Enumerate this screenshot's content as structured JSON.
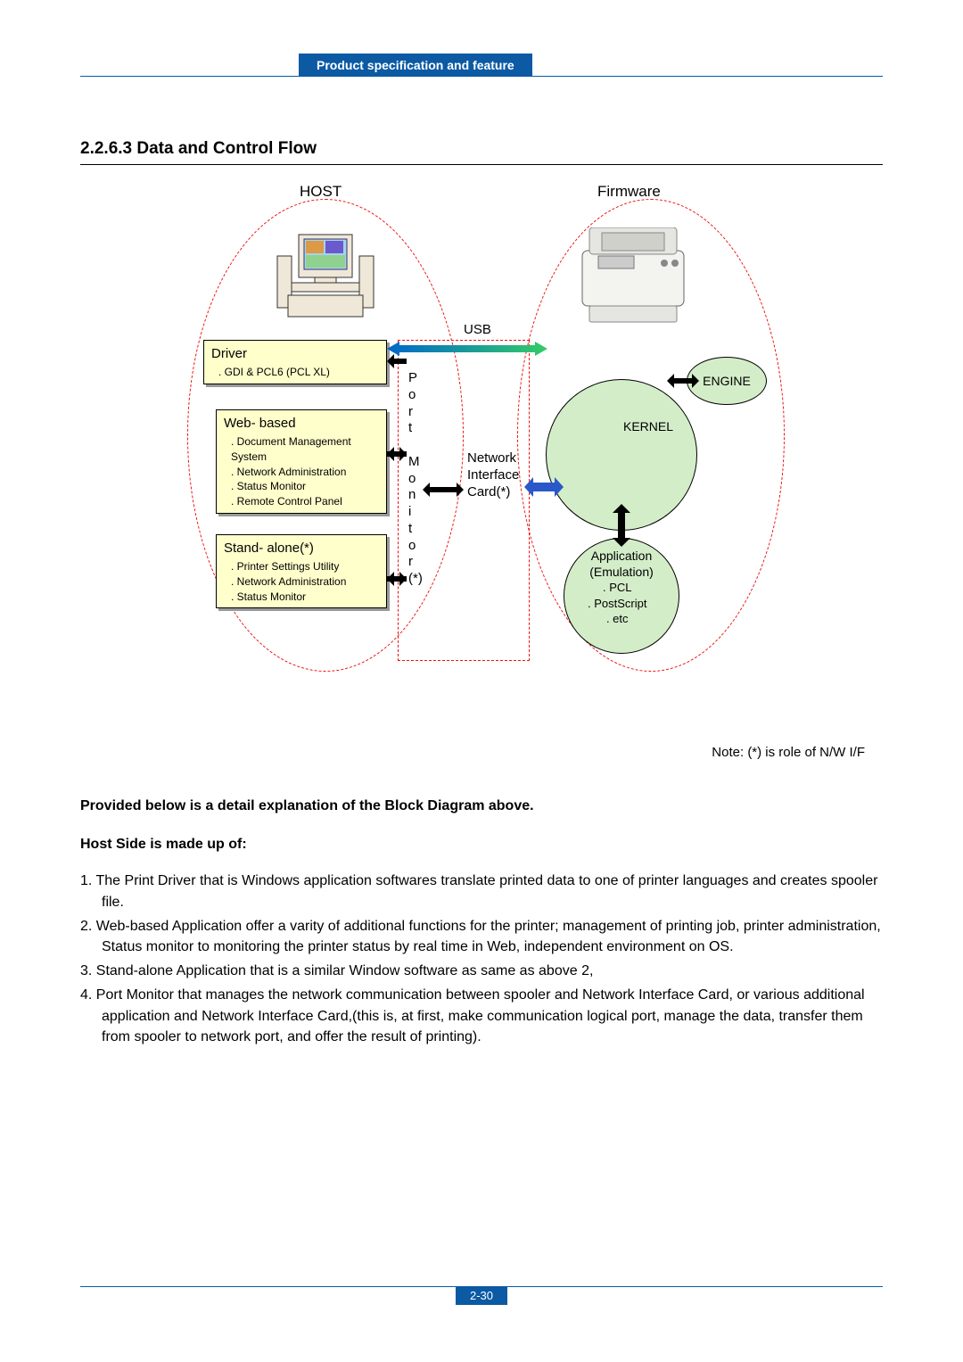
{
  "header": {
    "tab": "Product specification and feature"
  },
  "title": "2.2.6.3 Data and Control Flow",
  "diagram": {
    "host_label": "HOST",
    "firmware_label": "Firmware",
    "usb": "USB",
    "port_monitor": "P\no\nr\nt\n \nM\no\nn\ni\nt\no\nr\n(*)",
    "nic": "Network Interface Card(*)",
    "driver": {
      "hdr": "Driver",
      "items": [
        ". GDI & PCL6 (PCL XL)"
      ]
    },
    "web": {
      "hdr": "Web- based",
      "items": [
        ". Document  Management System",
        ". Network Administration",
        ". Status Monitor",
        ". Remote Control Panel"
      ]
    },
    "standalone": {
      "hdr": "Stand- alone(*)",
      "items": [
        ". Printer Settings Utility",
        ". Network Administration",
        ". Status Monitor"
      ]
    },
    "kernel": "KERNEL",
    "engine": "ENGINE",
    "app": {
      "title": "Application (Emulation)",
      "items": [
        ". PCL",
        ". PostScript",
        ". etc"
      ]
    }
  },
  "note": "Note: (*) is role of N/W I/F",
  "explain_head": "Provided below is a detail explanation of the Block Diagram above.",
  "hostside_head": "Host Side is made up of:",
  "items": [
    "1. The Print Driver that is Windows application softwares translate printed data to one of printer languages and creates spooler file.",
    "2. Web-based Application offer a varity of additional functions for the printer; management of printing job, printer administration, Status monitor to monitoring the printer status by real time in Web, independent environment on OS.",
    "3. Stand-alone Application that is a similar Window software as same as above 2,",
    "4. Port Monitor that manages the network communication between spooler and Network Interface Card, or various additional application and Network Interface Card,(this is, at first, make communication logical port, manage the data, transfer them from spooler to network port, and offer the result of printing)."
  ],
  "page_number": "2-30"
}
